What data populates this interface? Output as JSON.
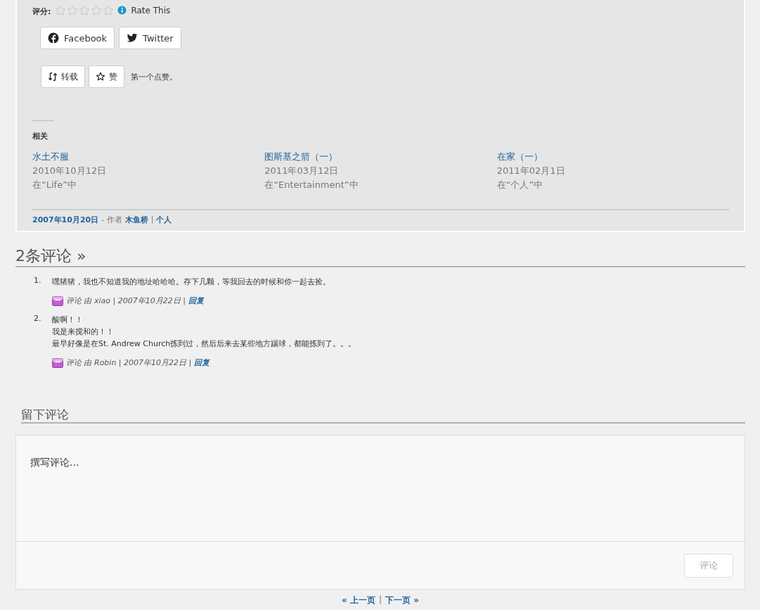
{
  "rating": {
    "label": "评分:",
    "stars": 0,
    "link": "Rate This"
  },
  "share_buttons": [
    {
      "kind": "facebook",
      "label": "Facebook"
    },
    {
      "kind": "twitter",
      "label": "Twitter"
    }
  ],
  "action_buttons": [
    {
      "kind": "reblog",
      "label": "转载"
    },
    {
      "kind": "like",
      "label": "赞"
    }
  ],
  "like_note": "第一个点赞。",
  "related": {
    "heading": "相关",
    "items": [
      {
        "title": "水土不服",
        "date": "2010年10月12日",
        "category": "在“Life”中"
      },
      {
        "title": "图斯基之箭（一）",
        "date": "2011年03月12日",
        "category": "在“Entertainment”中"
      },
      {
        "title": "在家（一）",
        "date": "2011年02月1日",
        "category": "在“个人”中"
      }
    ]
  },
  "post_meta": {
    "date": "2007年10月20日",
    "author_label": "- 作者",
    "author": "木鱼桥",
    "separator": "|",
    "category": "个人"
  },
  "comments": {
    "heading": "2条评论 »",
    "items": [
      {
        "number": "1.",
        "lines": [
          "嘿猪猪，我也不知道我的地址哈哈哈。存下几颗，等我回去的时候和你一起去捡。"
        ],
        "meta": "评论 由 xiao | 2007年10月22日 |",
        "reply": "回复"
      },
      {
        "number": "2.",
        "lines": [
          "酸啊！！",
          "我是来搅和的！！",
          "最早好像是在St. Andrew Church拣到过，然后后来去某些地方踢球，都能拣到了。。。"
        ],
        "meta": "评论 由 Robin | 2007年10月22日 |",
        "reply": "回复"
      }
    ]
  },
  "reply_form": {
    "heading": "留下评论",
    "placeholder": "撰写评论...",
    "submit": "评论",
    "submit_disabled": true
  },
  "pagination": {
    "previous": "« 上一页",
    "separator": "|",
    "next": "下一页 »"
  }
}
